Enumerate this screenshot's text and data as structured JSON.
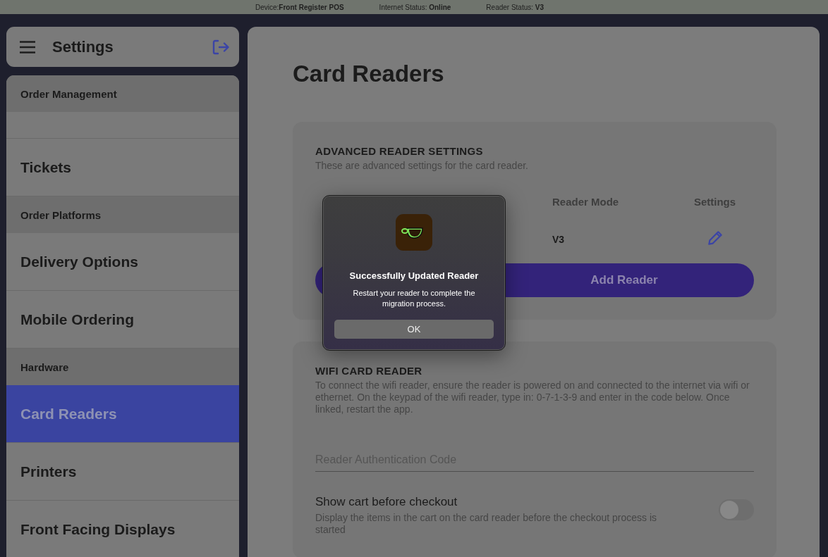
{
  "status_bar": [
    {
      "label": "Device:",
      "value": "Front Register POS"
    },
    {
      "label": "Internet Status: ",
      "value": "Online"
    },
    {
      "label": "Reader Status: ",
      "value": "V3"
    }
  ],
  "sidebar": {
    "title": "Settings",
    "items": [
      {
        "kind": "section",
        "label": "Order Management"
      },
      {
        "kind": "blank"
      },
      {
        "kind": "item",
        "label": "Tickets",
        "selected": false
      },
      {
        "kind": "section",
        "label": "Order Platforms"
      },
      {
        "kind": "item",
        "label": "Delivery Options",
        "selected": false
      },
      {
        "kind": "item",
        "label": "Mobile Ordering",
        "selected": false
      },
      {
        "kind": "section",
        "label": "Hardware"
      },
      {
        "kind": "item",
        "label": "Card Readers",
        "selected": true
      },
      {
        "kind": "item",
        "label": "Printers",
        "selected": false
      },
      {
        "kind": "item",
        "label": "Front Facing Displays",
        "selected": false
      }
    ]
  },
  "page_title": "Card Readers",
  "advanced": {
    "heading": "ADVANCED READER SETTINGS",
    "description": "These are advanced settings for the card reader.",
    "columns": [
      "Reader Mode",
      "Settings"
    ],
    "rows": [
      {
        "reader_mode": "V3"
      }
    ],
    "add_button": "Add Reader"
  },
  "wifi": {
    "heading": "WIFI CARD READER",
    "description": "To connect the wifi reader, ensure the reader is powered on and connected to the internet via wifi or ethernet. On the keypad of the wifi reader, type in: 0-7-1-3-9 and enter in the code below. Once linked, restart the app.",
    "field": {
      "placeholder": "Reader Authentication Code"
    },
    "toggle": {
      "label": "Show cart before checkout",
      "description": "Display the items in the cart on the card reader before the checkout process is started",
      "on": false
    }
  },
  "dialog": {
    "title": "Successfully Updated Reader",
    "message": "Restart your reader to complete the migration process.",
    "button": "OK"
  }
}
